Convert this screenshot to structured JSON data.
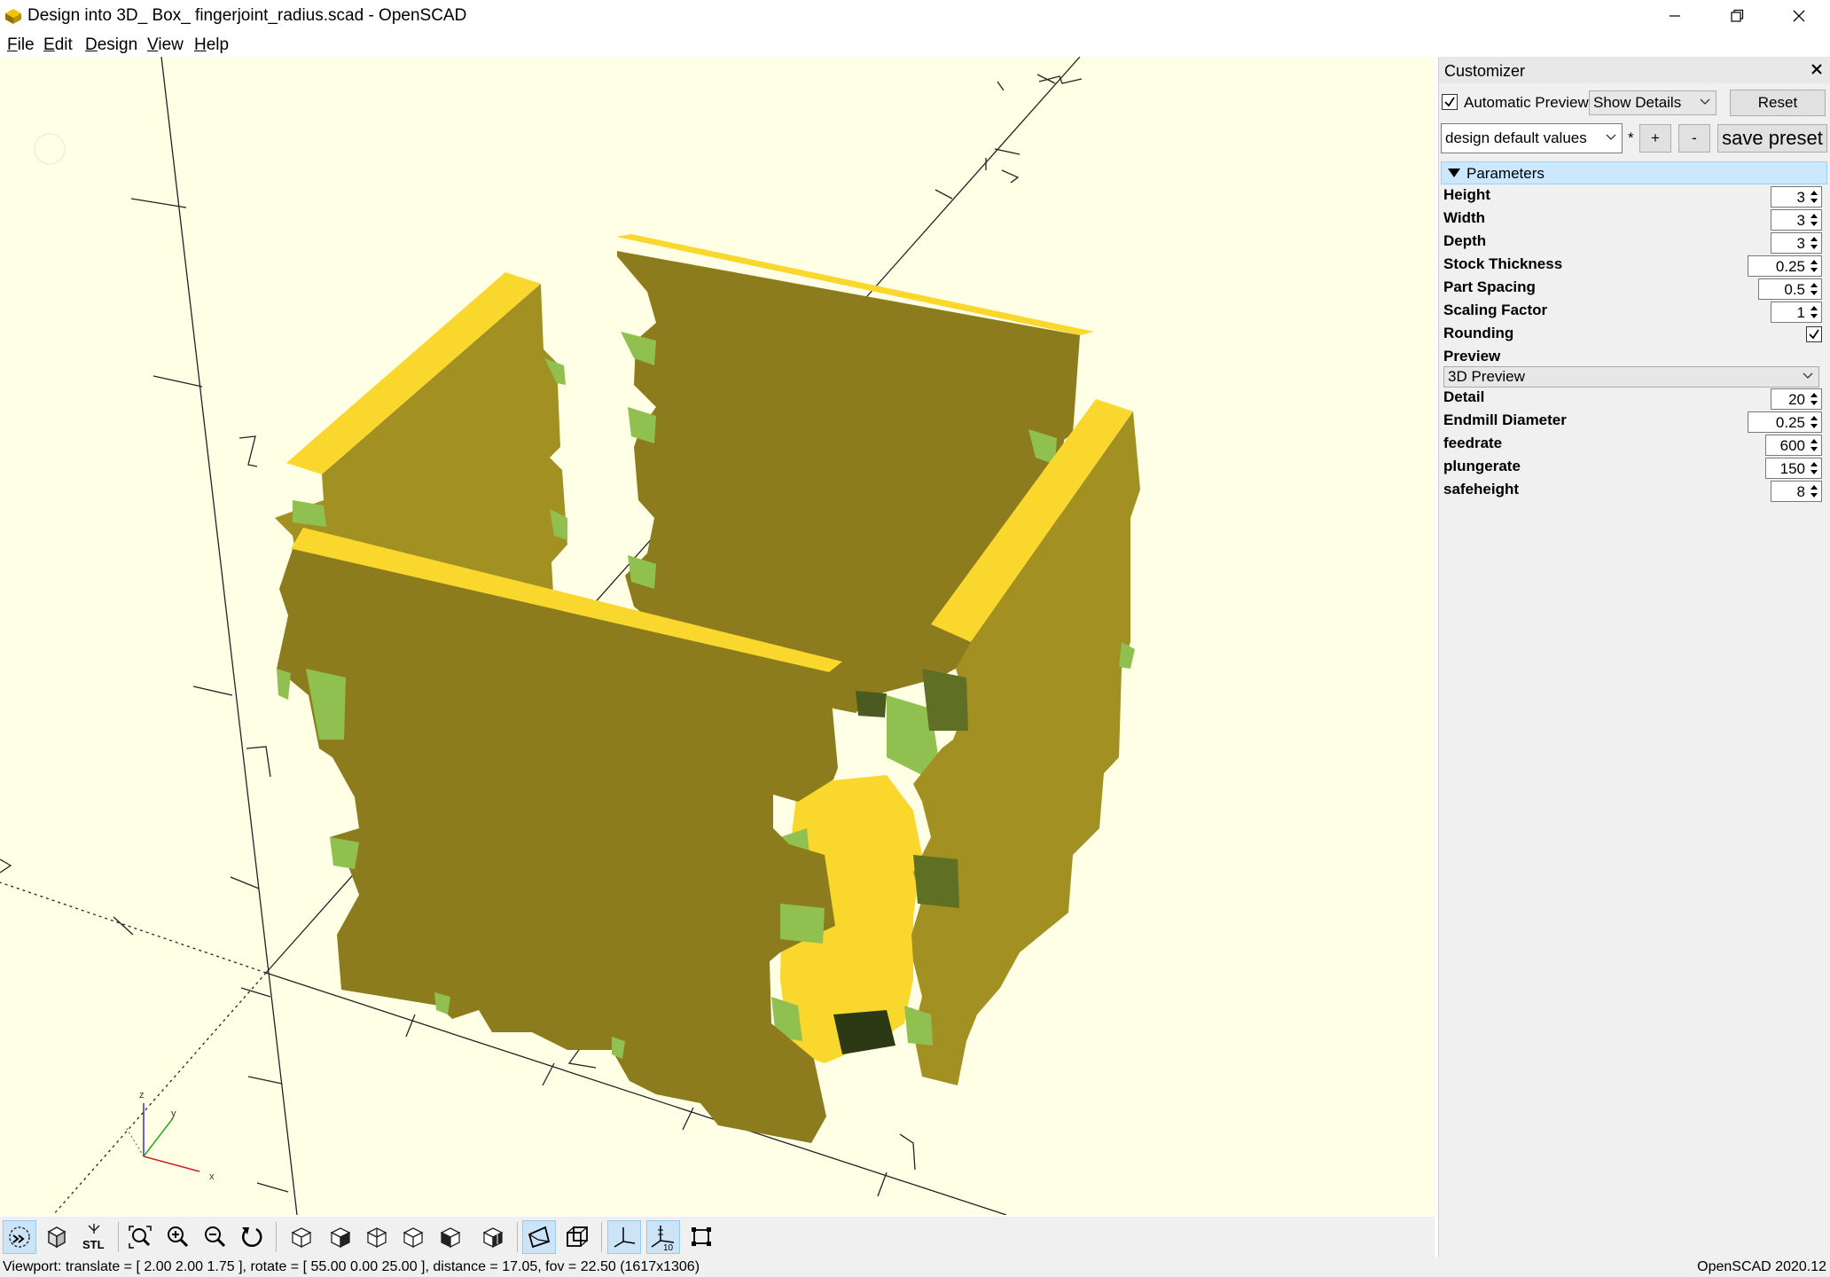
{
  "window": {
    "title": "Design into 3D_ Box_ fingerjoint_radius.scad - OpenSCAD",
    "icon": "openscad-app-icon",
    "controls": [
      "minimize-icon",
      "restore-icon",
      "close-icon"
    ]
  },
  "menubar": {
    "items": [
      {
        "label": "File",
        "mnemonic": "F",
        "rest": "ile"
      },
      {
        "label": "Edit",
        "mnemonic": "E",
        "rest": "dit"
      },
      {
        "label": "Design",
        "mnemonic": "D",
        "rest": "esign"
      },
      {
        "label": "View",
        "mnemonic": "V",
        "rest": "iew"
      },
      {
        "label": "Help",
        "mnemonic": "H",
        "rest": "elp"
      }
    ]
  },
  "viewport": {
    "background": "#ffffe5",
    "model_colors": {
      "top_face": "#f9d72c",
      "front_face": "#8d7c1e",
      "side_face": "#a29022",
      "inner_face": "#90c050"
    },
    "axis_labels": {
      "z": "z",
      "y": "y",
      "x": "x"
    }
  },
  "toolbar": {
    "buttons": [
      {
        "icon": "preview-icon",
        "active": true
      },
      {
        "icon": "render-icon",
        "active": false
      },
      {
        "icon": "export-stl-icon",
        "label": "STL",
        "active": false
      },
      {
        "icon": "view-all-icon",
        "active": false
      },
      {
        "icon": "zoom-in-icon",
        "active": false
      },
      {
        "icon": "zoom-out-icon",
        "active": false
      },
      {
        "icon": "reset-view-icon",
        "active": false
      },
      {
        "icon": "view-right-icon",
        "active": false
      },
      {
        "icon": "view-top-icon",
        "active": false
      },
      {
        "icon": "view-bottom-icon",
        "active": false
      },
      {
        "icon": "view-left-icon",
        "active": false
      },
      {
        "icon": "view-front-icon",
        "active": false
      },
      {
        "icon": "view-back-icon",
        "active": false
      },
      {
        "icon": "perspective-icon",
        "active": true
      },
      {
        "icon": "orthogonal-icon",
        "active": false
      },
      {
        "icon": "show-axes-icon",
        "active": true
      },
      {
        "icon": "show-scale-markers-icon",
        "label": "10",
        "active": true
      },
      {
        "icon": "show-edges-icon",
        "active": false
      }
    ]
  },
  "statusbar": {
    "viewport_info": "Viewport: translate = [ 2.00 2.00 1.75 ], rotate = [ 55.00 0.00 25.00 ], distance = 17.05, fov = 22.50 (1617x1306)",
    "version": "OpenSCAD 2020.12"
  },
  "customizer": {
    "title": "Customizer",
    "automatic_preview_label": "Automatic Preview",
    "automatic_preview_checked": true,
    "details_mode": "Show Details",
    "reset_label": "Reset",
    "preset": "design default values",
    "preset_modified_marker": "*",
    "add_preset_label": "+",
    "remove_preset_label": "-",
    "save_preset_label": "save preset",
    "group_label": "Parameters",
    "params": [
      {
        "name": "Height",
        "value": "3"
      },
      {
        "name": "Width",
        "value": "3"
      },
      {
        "name": "Depth",
        "value": "3"
      },
      {
        "name": "Stock Thickness",
        "value": "0.25"
      },
      {
        "name": "Part Spacing",
        "value": "0.5"
      },
      {
        "name": "Scaling Factor",
        "value": "1"
      }
    ],
    "rounding": {
      "name": "Rounding",
      "checked": true
    },
    "preview": {
      "name": "Preview",
      "value": "3D Preview"
    },
    "params2": [
      {
        "name": "Detail",
        "value": "20"
      },
      {
        "name": "Endmill Diameter",
        "value": "0.25"
      },
      {
        "name": "feedrate",
        "value": "600"
      },
      {
        "name": "plungerate",
        "value": "150"
      },
      {
        "name": "safeheight",
        "value": "8"
      }
    ]
  }
}
